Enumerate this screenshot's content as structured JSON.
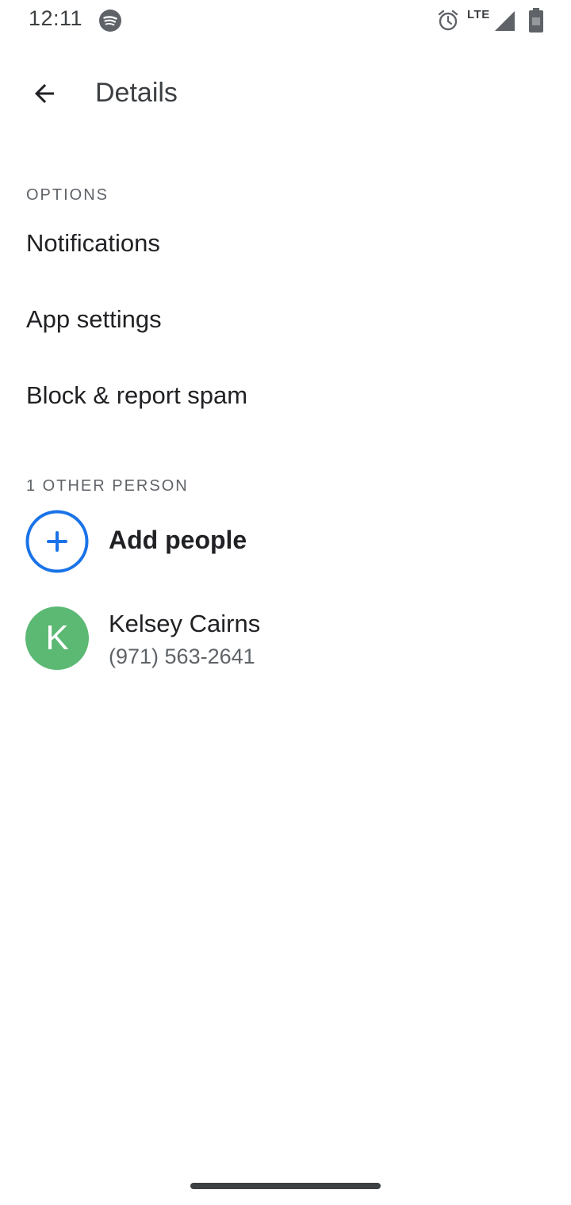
{
  "status_bar": {
    "time": "12:11",
    "network": "LTE",
    "icons": [
      "spotify-icon",
      "alarm-icon",
      "signal-icon",
      "battery-icon"
    ]
  },
  "app_bar": {
    "title": "Details",
    "back_icon": "arrow-back-icon"
  },
  "options": {
    "header": "OPTIONS",
    "items": [
      {
        "label": "Notifications"
      },
      {
        "label": "App settings"
      },
      {
        "label": "Block & report spam"
      }
    ]
  },
  "people": {
    "header": "1 OTHER PERSON",
    "add_label": "Add people",
    "contacts": [
      {
        "initial": "K",
        "name": "Kelsey Cairns",
        "phone": "(971) 563-2641"
      }
    ]
  },
  "colors": {
    "accent_blue": "#1a73e8",
    "avatar_green": "#5bb974",
    "text_primary": "#202124",
    "text_secondary": "#5f6368"
  }
}
